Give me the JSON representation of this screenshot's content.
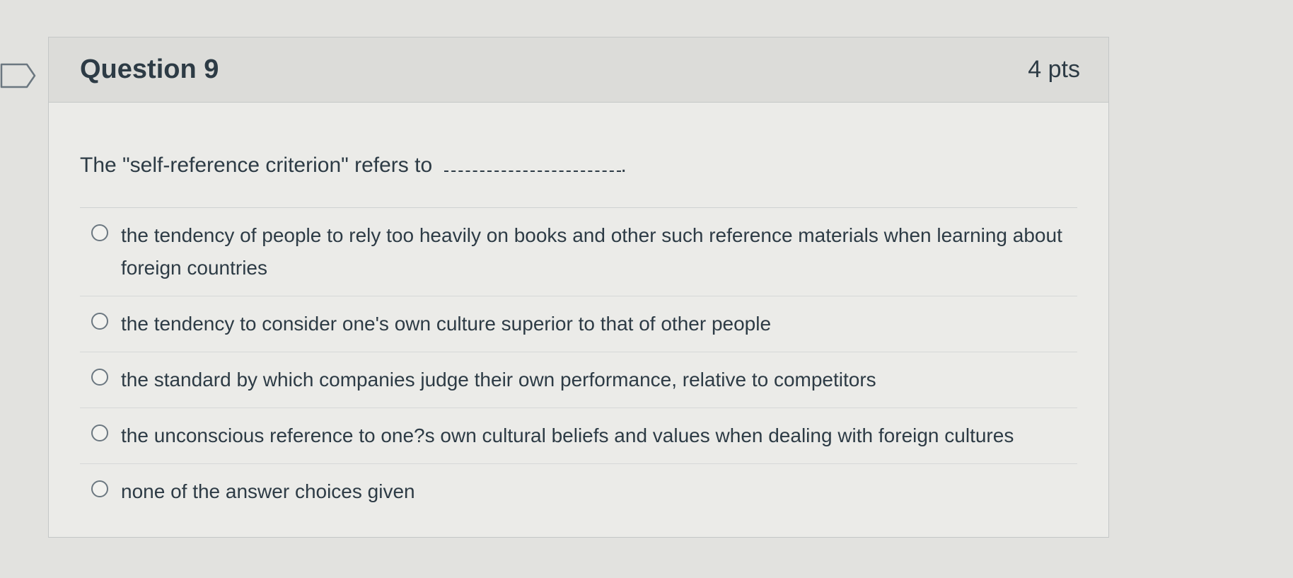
{
  "question": {
    "title": "Question 9",
    "points": "4 pts",
    "prompt": "The \"self-reference criterion\" refers to",
    "blank_end": "."
  },
  "answers": [
    {
      "label": "the tendency of people to rely too heavily on books and other such reference materials when learning about foreign countries"
    },
    {
      "label": "the tendency to consider one's own culture superior to that of other people"
    },
    {
      "label": "the standard by which companies judge their own performance, relative to competitors"
    },
    {
      "label": "the unconscious reference to one?s own cultural beliefs and values when dealing with foreign cultures"
    },
    {
      "label": "none of the answer choices given"
    }
  ],
  "icons": {
    "bookmark": "bookmark-flag-icon",
    "radio": "radio-button-icon"
  },
  "colors": {
    "background": "#e2e2df",
    "header": "#dcdcd9",
    "text": "#2d3b45",
    "border": "#c4c7c7"
  }
}
